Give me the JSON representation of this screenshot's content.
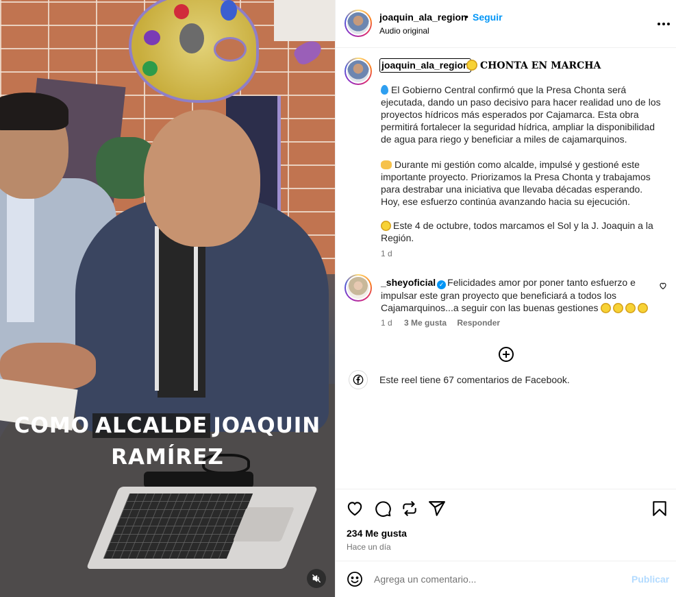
{
  "media": {
    "caption_line1_a": "COMO",
    "caption_line1_b": "ALCALDE",
    "caption_line1_c": "JOAQUIN",
    "caption_line2": "RAMÍREZ",
    "mute_icon": "speaker-muted-icon"
  },
  "header": {
    "username": "joaquin_ala_region",
    "separator": "•",
    "follow_label": "Seguir",
    "audio_label": "Audio original",
    "more_icon": "more-horizontal-icon"
  },
  "post": {
    "username": "joaquin_ala_region",
    "title": "CHONTA EN MARCHA",
    "paragraph1": "El Gobierno Central confirmó que la Presa Chonta será ejecutada, dando un paso decisivo para hacer realidad uno de los proyectos hídricos más esperados por Cajamarca. Esta obra permitirá fortalecer la seguridad hídrica, ampliar la disponibilidad de agua para riego y beneficiar a miles de cajamarquinos.",
    "paragraph2": "Durante mi gestión como alcalde, impulsé y gestioné este importante proyecto. Priorizamos la Presa Chonta y trabajamos para destrabar una iniciativa que llevaba décadas esperando. Hoy, ese esfuerzo continúa avanzando hacia su ejecución.",
    "paragraph3": "Este 4 de octubre, todos marcamos el Sol y la J. Joaquin a la Región.",
    "age": "1 d"
  },
  "comment": {
    "username": "_sheyoficial",
    "text": "Felicidades amor por poner tanto esfuerzo e impulsar este gran proyecto que beneficiará a todos los Cajamarquinos...a seguir con las buenas gestiones",
    "age": "1 d",
    "likes": "3 Me gusta",
    "reply_label": "Responder"
  },
  "facebook_note": "Este reel tiene 67 comentarios de Facebook.",
  "actions": {
    "like_count": "234 Me gusta",
    "timestamp": "Hace un día"
  },
  "composer": {
    "placeholder": "Agrega un comentario...",
    "publish_label": "Publicar"
  },
  "colors": {
    "link_blue": "#0095f6",
    "publish_disabled": "#b3dbff",
    "muted_text": "#737373"
  }
}
